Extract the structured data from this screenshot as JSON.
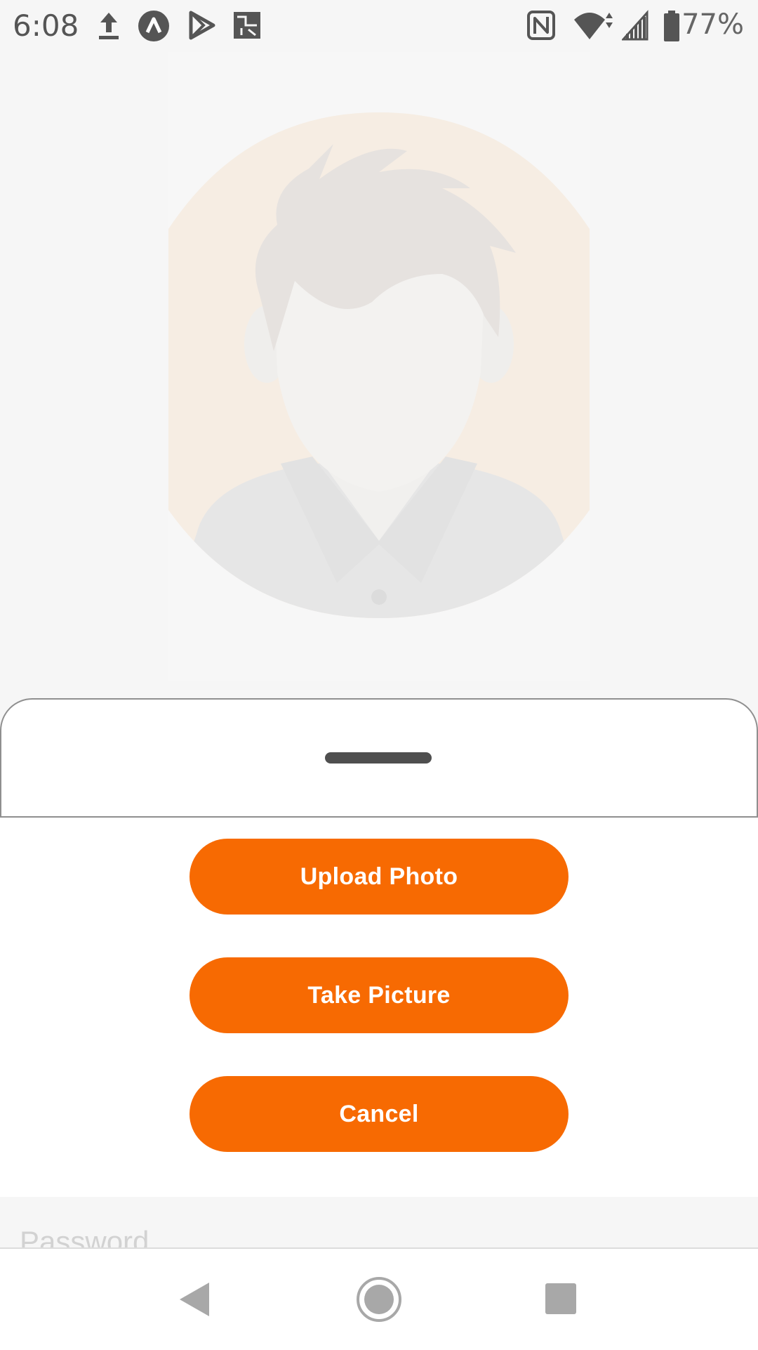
{
  "status_bar": {
    "time": "6:08",
    "battery_percent": "77%",
    "icons": [
      "upload-icon",
      "app-a-icon",
      "play-store-icon",
      "photo-app-icon",
      "nfc-icon",
      "wifi-icon",
      "cell-signal-icon",
      "battery-icon"
    ]
  },
  "avatar": {
    "icon": "avatar-placeholder-icon",
    "colors": {
      "background": "#f6ede3",
      "hair": "#e6e2df",
      "face": "#f3f2f0",
      "shirt": "#e6e6e6"
    }
  },
  "sheet": {
    "buttons": {
      "upload_photo": "Upload Photo",
      "take_picture": "Take Picture",
      "cancel": "Cancel"
    },
    "accent": "#f76a02"
  },
  "form": {
    "password_placeholder": "Password"
  },
  "nav": {
    "back": "back-icon",
    "home": "home-icon",
    "recents": "recents-icon"
  }
}
